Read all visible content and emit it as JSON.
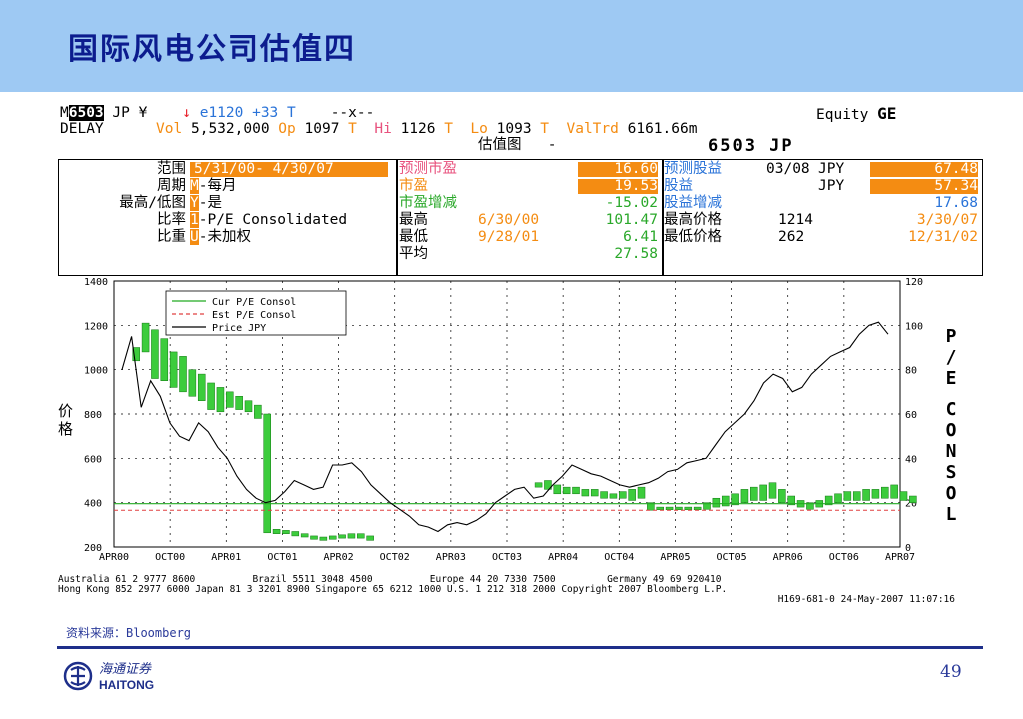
{
  "slide": {
    "title": "国际风电公司估值四",
    "source": "资料来源：Bloomberg",
    "page_number": "49"
  },
  "logo": {
    "name": "海通证券",
    "latin": "HAITONG"
  },
  "terminal": {
    "line1": {
      "m": "M",
      "ticker": "6503",
      "market": "JP ¥",
      "arrow": "↓",
      "last_prefix": "e",
      "last": "1120",
      "change": "+33",
      "t": "T",
      "x": "--x--",
      "equity": "Equity",
      "func": "GE"
    },
    "line2": {
      "delay": "DELAY",
      "vol_label": "Vol",
      "vol": "5,532,000",
      "op_label": "Op",
      "op": "1097",
      "t1": "T",
      "hi_label": "Hi",
      "hi": "1126",
      "t2": "T",
      "lo_label": "Lo",
      "lo": "1093",
      "t3": "T",
      "valtrd_label": "ValTrd",
      "valtrd": "6161.66m"
    },
    "line3": {
      "chart_name": "估值图",
      "dash": "-",
      "security": "6503 JP"
    },
    "left": {
      "range_label": "范围",
      "range_value": "5/31/00- 4/30/07",
      "period_label": "周期",
      "period_key": "M",
      "period_value": "-每月",
      "hilo_label": "最高/低图",
      "hilo_key": "Y",
      "hilo_value": "-是",
      "ratio_label": "比率",
      "ratio_key": "1",
      "ratio_value": "-P/E Consolidated",
      "weight_label": "比重",
      "weight_key": "U",
      "weight_value": "-未加权"
    },
    "mid": {
      "est_pe_label": "预测市盈",
      "est_pe": "16.60",
      "pe_label": "市盈",
      "pe": "19.53",
      "pe_chg_label": "市盈增减",
      "pe_chg": "-15.02",
      "high_label": "最高",
      "high_date": "6/30/00",
      "high": "101.47",
      "low_label": "最低",
      "low_date": "9/28/01",
      "low": "6.41",
      "avg_label": "平均",
      "avg": "27.58"
    },
    "right": {
      "est_eps_label": "预测股益",
      "est_eps_date": "03/08",
      "est_eps_cur": "JPY",
      "est_eps": "67.48",
      "eps_label": "股益",
      "eps_cur": "JPY",
      "eps": "57.34",
      "eps_chg_label": "股益增减",
      "eps_chg": "17.68",
      "max_price_label": "最高价格",
      "max_price": "1214",
      "max_date": "3/30/07",
      "min_price_label": "最低价格",
      "min_price": "262",
      "min_date": "12/31/02"
    },
    "footer1": "Australia 61 2 9777 8600          Brazil 5511 3048 4500          Europe 44 20 7330 7500         Germany 49 69 920410",
    "footer2": "Hong Kong 852 2977 6000 Japan 81 3 3201 8900 Singapore 65 6212 1000 U.S. 1 212 318 2000 Copyright 2007 Bloomberg L.P.",
    "footer3": "H169-681-0 24-May-2007 11:07:16"
  },
  "chart_data": {
    "type": "line",
    "left_axis_label": "价格",
    "right_axis_label": "P/E CONSOL",
    "left_ticks": [
      "1400",
      "1200",
      "1000",
      "800",
      "600",
      "400",
      "200"
    ],
    "left_ylim": [
      200,
      1400
    ],
    "right_ticks": [
      "120",
      "100",
      "80",
      "60",
      "40",
      "20",
      "0"
    ],
    "right_ylim": [
      0,
      120
    ],
    "x_ticks": [
      "APR00",
      "OCT00",
      "APR01",
      "OCT01",
      "APR02",
      "OCT02",
      "APR03",
      "OCT03",
      "APR04",
      "OCT04",
      "APR05",
      "OCT05",
      "APR06",
      "OCT06",
      "APR07"
    ],
    "legend": [
      {
        "name": "Cur P/E Consol",
        "color": "#22aa22",
        "style": "solid"
      },
      {
        "name": "Est P/E Consol",
        "color": "#e04040",
        "style": "dashed"
      },
      {
        "name": "Price JPY",
        "color": "#000000",
        "style": "solid"
      }
    ],
    "cur_pe": 19.53,
    "est_pe": 16.6,
    "price_jpy": [
      1000,
      1150,
      830,
      950,
      880,
      760,
      700,
      680,
      760,
      720,
      650,
      600,
      520,
      460,
      420,
      400,
      410,
      450,
      500,
      480,
      460,
      470,
      570,
      570,
      580,
      540,
      480,
      440,
      400,
      370,
      340,
      300,
      290,
      270,
      300,
      310,
      300,
      320,
      350,
      400,
      430,
      460,
      470,
      420,
      430,
      480,
      520,
      570,
      550,
      530,
      520,
      500,
      480,
      470,
      480,
      490,
      510,
      540,
      550,
      580,
      590,
      600,
      660,
      720,
      760,
      800,
      860,
      940,
      980,
      960,
      900,
      920,
      980,
      1020,
      1060,
      1080,
      1100,
      1160,
      1200,
      1214,
      1160
    ],
    "pe_hilo": [
      [
        90,
        84
      ],
      [
        101,
        88
      ],
      [
        98,
        76
      ],
      [
        94,
        75
      ],
      [
        88,
        72
      ],
      [
        86,
        70
      ],
      [
        80,
        68
      ],
      [
        78,
        66
      ],
      [
        74,
        62
      ],
      [
        72,
        61
      ],
      [
        70,
        63
      ],
      [
        68,
        62
      ],
      [
        66,
        61
      ],
      [
        64,
        58
      ],
      [
        60,
        6.41
      ],
      [
        8,
        6
      ],
      [
        7.5,
        6
      ],
      [
        7,
        5
      ],
      [
        6,
        4.5
      ],
      [
        5,
        3.5
      ],
      [
        4.5,
        3
      ],
      [
        5,
        3.5
      ],
      [
        5.5,
        4
      ],
      [
        6,
        4
      ],
      [
        6,
        4
      ],
      [
        5,
        3
      ]
    ],
    "pe_hilo_late": [
      [
        29,
        27
      ],
      [
        30,
        26
      ],
      [
        28,
        24
      ],
      [
        27,
        24
      ],
      [
        27,
        24
      ],
      [
        26,
        23
      ],
      [
        26,
        23
      ],
      [
        25,
        22
      ],
      [
        24,
        22
      ],
      [
        25,
        22
      ],
      [
        26,
        21
      ],
      [
        27,
        22
      ],
      [
        20,
        16.6
      ],
      [
        18,
        16.8
      ],
      [
        18,
        16.8
      ],
      [
        18,
        16.8
      ],
      [
        18,
        16.8
      ],
      [
        18,
        16.8
      ],
      [
        20,
        17
      ],
      [
        22,
        18
      ],
      [
        23,
        18.5
      ],
      [
        24,
        19
      ],
      [
        26,
        20
      ],
      [
        27,
        21
      ],
      [
        28,
        21
      ],
      [
        29,
        22
      ],
      [
        26,
        20
      ],
      [
        23,
        19
      ],
      [
        21,
        18
      ],
      [
        20,
        17
      ],
      [
        21,
        18
      ],
      [
        23,
        19
      ],
      [
        24,
        20
      ],
      [
        25,
        21
      ],
      [
        25,
        21
      ],
      [
        26,
        21
      ],
      [
        26,
        22
      ],
      [
        27,
        22
      ],
      [
        28,
        22
      ],
      [
        25,
        21
      ],
      [
        23,
        20
      ]
    ]
  }
}
